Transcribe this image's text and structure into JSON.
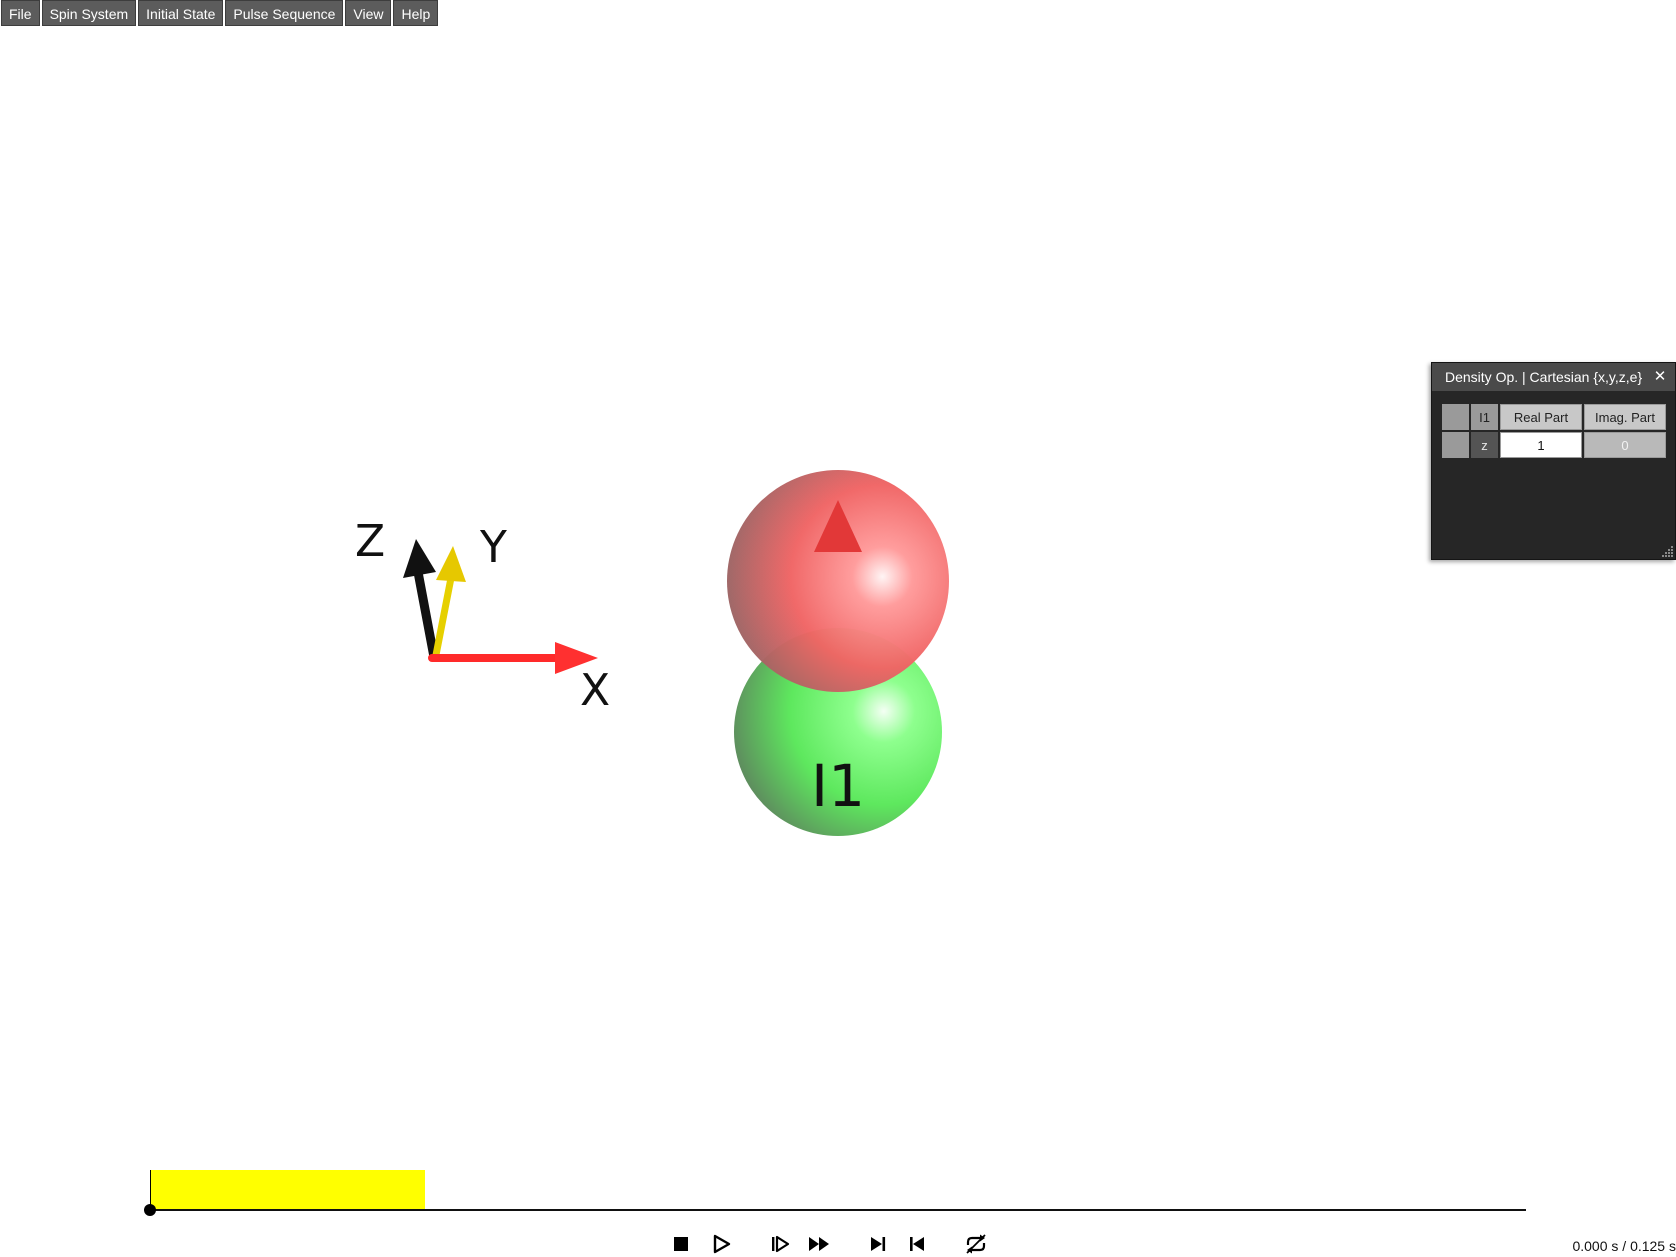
{
  "menubar": {
    "items": [
      {
        "label": "File"
      },
      {
        "label": "Spin System"
      },
      {
        "label": "Initial State"
      },
      {
        "label": "Pulse Sequence"
      },
      {
        "label": "View"
      },
      {
        "label": "Help"
      }
    ]
  },
  "scene": {
    "axes": {
      "x_label": "X",
      "y_label": "Y",
      "z_label": "Z"
    },
    "spin": {
      "label": "I1"
    },
    "colors": {
      "x_axis": "#ff2a2a",
      "y_axis": "#e6d000",
      "z_axis": "#111111",
      "magnetization_sphere": "#ff6666",
      "nucleus_sphere": "#66ff66",
      "magnetization_arrow": "#e03030"
    }
  },
  "density_panel": {
    "title": "Density Op. | Cartesian {x,y,z,e}",
    "close_glyph": "✕",
    "header": {
      "spin": "I1",
      "real": "Real Part",
      "imag": "Imag. Part"
    },
    "rows": [
      {
        "component": "z",
        "real": "1",
        "imag": "0"
      }
    ]
  },
  "timeline": {
    "progress_fraction": 0,
    "pulse_block_color": "#ffff00",
    "controls": [
      {
        "name": "stop-icon"
      },
      {
        "name": "play-icon"
      },
      {
        "name": "step-forward-icon"
      },
      {
        "name": "fast-forward-icon"
      },
      {
        "name": "skip-to-end-icon"
      },
      {
        "name": "skip-to-start-icon"
      },
      {
        "name": "loop-icon"
      }
    ],
    "time": {
      "current": "0.000 s",
      "separator": " / ",
      "total": "0.125 s"
    }
  }
}
